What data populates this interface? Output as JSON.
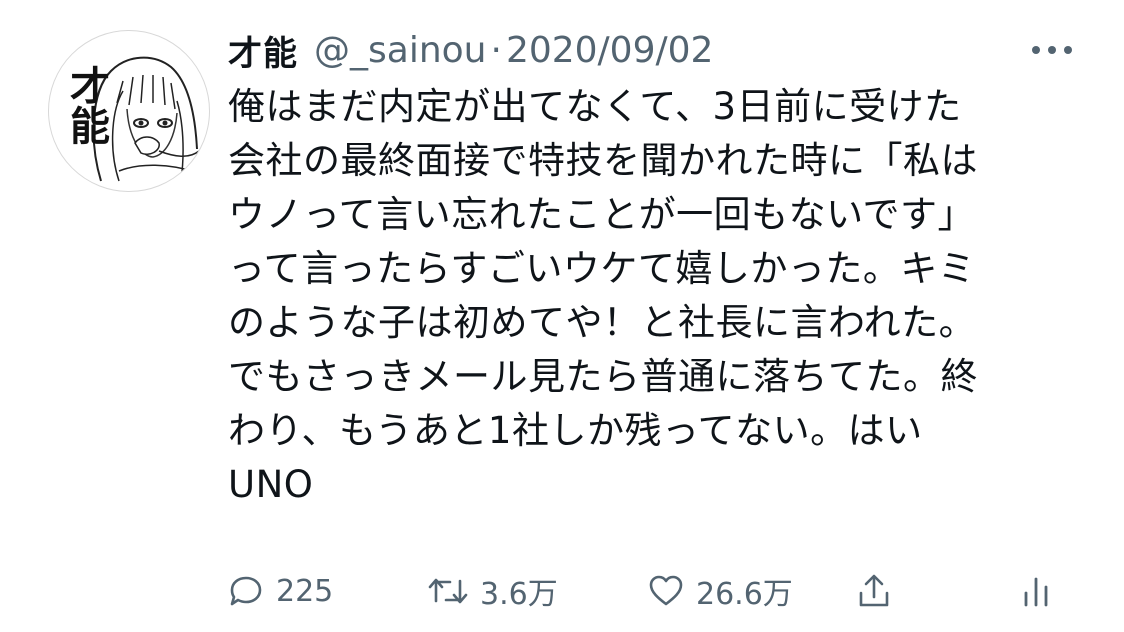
{
  "tweet": {
    "display_name": "才能",
    "handle": "@_sainou",
    "separator": "·",
    "date": "2020/09/02",
    "avatar_text": "才能",
    "text_lines": [
      "俺はまだ内定が出てなくて、3日前に受けた",
      "会社の最終面接で特技を聞かれた時に「私は",
      "ウノって言い忘れたことが一回もないです」",
      "って言ったらすごいウケて嬉しかった。キミ",
      "のような子は初めてや！と社長に言われた。",
      "でもさっきメール見たら普通に落ちてた。終",
      "わり、もうあと1社しか残ってない。はい",
      "UNO"
    ]
  },
  "actions": {
    "reply": {
      "icon": "reply-icon",
      "count": "225"
    },
    "retweet": {
      "icon": "retweet-icon",
      "count": "3.6万"
    },
    "like": {
      "icon": "heart-icon",
      "count": "26.6万"
    },
    "share": {
      "icon": "share-icon"
    },
    "analytics": {
      "icon": "analytics-icon"
    }
  },
  "colors": {
    "primary_text": "#0f1419",
    "secondary_text": "#536471",
    "background": "#ffffff"
  }
}
